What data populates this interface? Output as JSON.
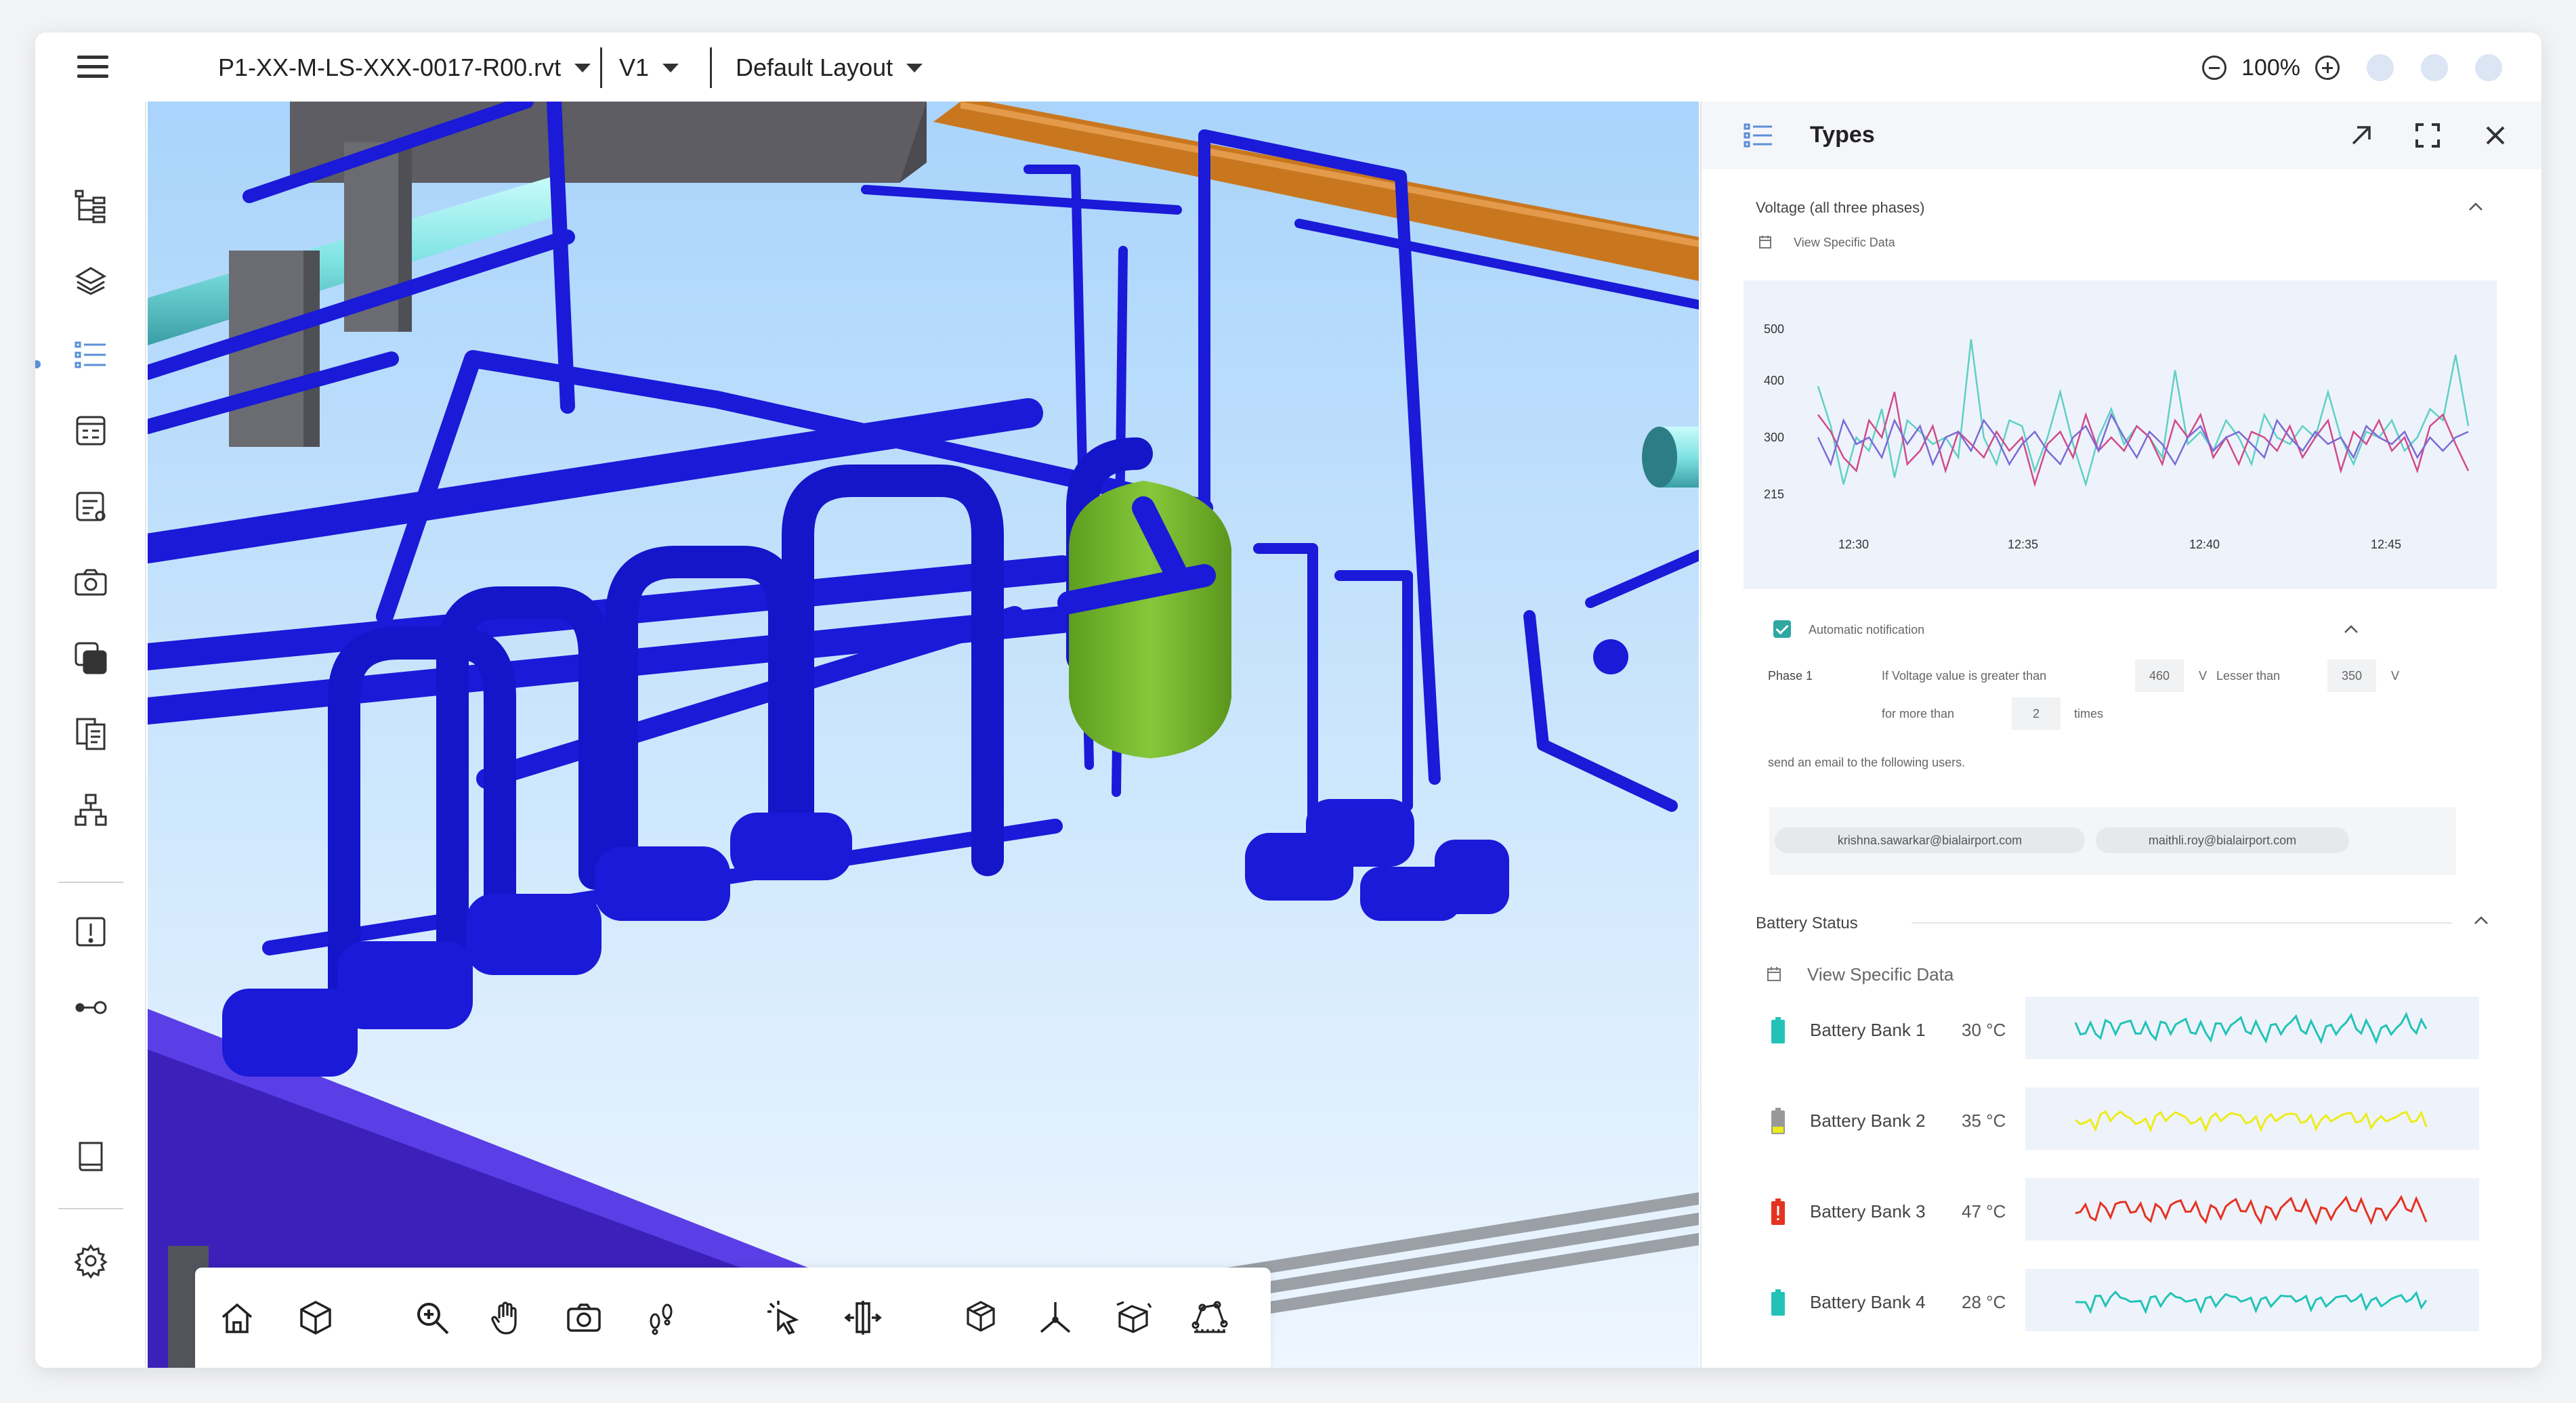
{
  "topbar": {
    "file_name": "P1-XX-M-LS-XXX-0017-R00.rvt",
    "version": "V1",
    "layout": "Default Layout",
    "zoom": "100%"
  },
  "panel": {
    "title": "Types",
    "voltage": {
      "title": "Voltage (all three phases)",
      "view_specific": "View Specific Data",
      "chart_data": {
        "type": "line",
        "y_ticks": [
          "500",
          "400",
          "300",
          "215"
        ],
        "x_ticks": [
          "12:30",
          "12:35",
          "12:40",
          "12:45"
        ],
        "ylim": [
          215,
          500
        ],
        "series": [
          {
            "color": "#5fd0c4",
            "values": [
              390,
              320,
              230,
              300,
              280,
              350,
              240,
              330,
              310,
              290,
              300,
              270,
              480,
              300,
              260,
              330,
              320,
              250,
              300,
              380,
              290,
              230,
              300,
              350,
              290,
              320,
              300,
              270,
              420,
              290,
              310,
              280,
              330,
              300,
              260,
              340,
              300,
              290,
              320,
              300,
              380,
              300,
              260,
              310,
              300,
              330,
              280,
              300,
              350,
              330,
              450,
              320
            ]
          },
          {
            "color": "#d14a8a",
            "values": [
              340,
              310,
              270,
              250,
              330,
              300,
              380,
              260,
              280,
              320,
              250,
              310,
              290,
              270,
              310,
              280,
              300,
              230,
              290,
              310,
              270,
              340,
              280,
              300,
              280,
              320,
              300,
              260,
              330,
              300,
              340,
              270,
              300,
              260,
              310,
              300,
              280,
              320,
              270,
              300,
              330,
              250,
              310,
              290,
              330,
              280,
              300,
              250,
              320,
              340,
              290,
              250
            ]
          },
          {
            "color": "#7a6ad8",
            "values": [
              300,
              260,
              330,
              290,
              300,
              270,
              330,
              290,
              320,
              260,
              300,
              310,
              280,
              330,
              300,
              260,
              290,
              310,
              280,
              260,
              300,
              320,
              280,
              340,
              300,
              270,
              310,
              290,
              260,
              300,
              320,
              280,
              300,
              310,
              290,
              270,
              330,
              300,
              280,
              310,
              290,
              300,
              270,
              320,
              300,
              290,
              310,
              270,
              300,
              280,
              300,
              310
            ]
          }
        ]
      }
    },
    "notification": {
      "label": "Automatic notification",
      "phase": "Phase 1",
      "cond1": "If Voltage value is greater than",
      "val1": "460",
      "unit1": "V",
      "cond2": "Lesser than",
      "val2": "350",
      "unit2": "V",
      "for_more": "for more than",
      "times_val": "2",
      "times_label": "times",
      "send_email": "send an email to the following users.",
      "emails": [
        "krishna.sawarkar@bialairport.com",
        "maithli.roy@bialairport.com"
      ]
    },
    "battery": {
      "title": "Battery Status",
      "view_specific": "View Specific Data",
      "banks": [
        {
          "name": "Battery  Bank 1",
          "temp": "30 °C",
          "color": "#22c3b6"
        },
        {
          "name": "Battery  Bank 2",
          "temp": "35 °C",
          "color": "#ecec1a"
        },
        {
          "name": "Battery  Bank 3",
          "temp": "47 °C",
          "color": "#e53322"
        },
        {
          "name": "Battery  Bank 4",
          "temp": "28 °C",
          "color": "#22c3b6"
        }
      ]
    }
  }
}
